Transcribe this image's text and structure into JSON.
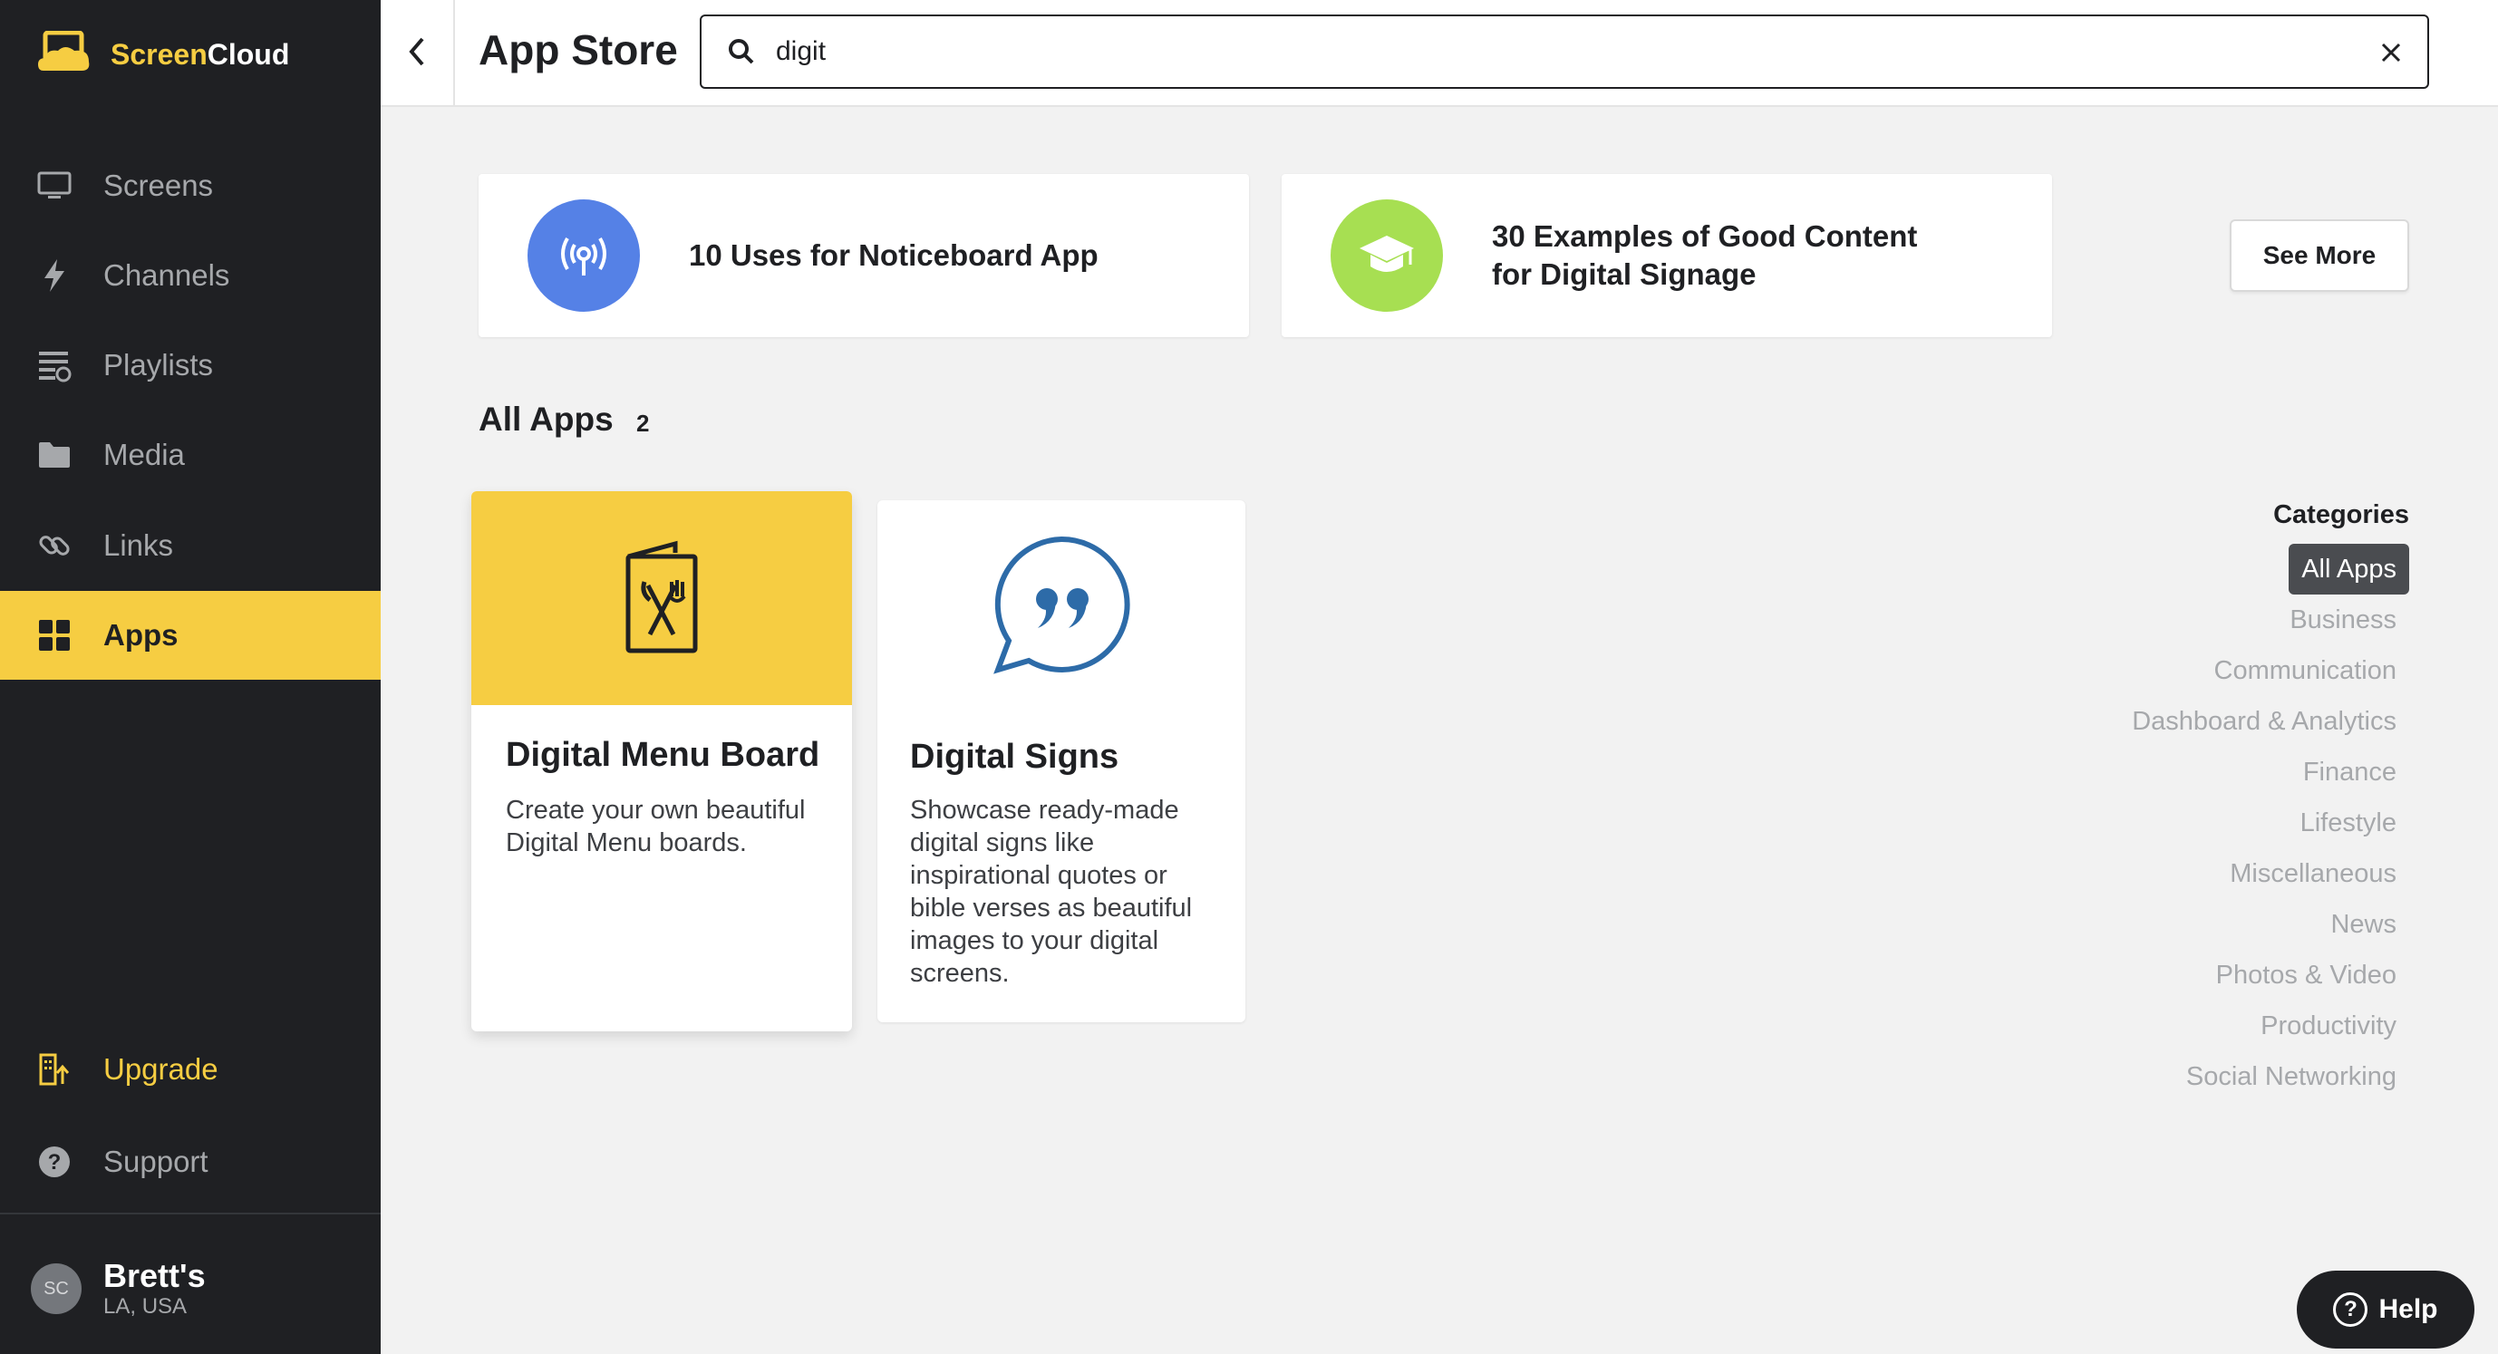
{
  "brand": {
    "name_part1": "Screen",
    "name_part2": "Cloud",
    "accent": "#f6cd42",
    "dark": "#1f2023"
  },
  "sidebar": {
    "items": [
      {
        "label": "Screens",
        "icon": "monitor-icon"
      },
      {
        "label": "Channels",
        "icon": "lightning-icon"
      },
      {
        "label": "Playlists",
        "icon": "playlist-icon"
      },
      {
        "label": "Media",
        "icon": "folder-icon"
      },
      {
        "label": "Links",
        "icon": "link-icon"
      },
      {
        "label": "Apps",
        "icon": "apps-grid-icon",
        "active": true
      }
    ],
    "upgrade": {
      "label": "Upgrade",
      "icon": "building-upgrade-icon"
    },
    "support": {
      "label": "Support",
      "icon": "question-icon"
    },
    "account": {
      "initials": "SC",
      "name": "Brett's",
      "location": "LA, USA"
    }
  },
  "header": {
    "title": "App Store",
    "search": {
      "value": "digit",
      "placeholder": ""
    }
  },
  "featured": [
    {
      "title": "10 Uses for Noticeboard App",
      "icon": "broadcast-icon",
      "color": "#5581e6"
    },
    {
      "title_line1": "30 Examples of Good Content",
      "title_line2": "for Digital Signage",
      "icon": "graduation-cap-icon",
      "color": "#a7df52"
    }
  ],
  "see_more_label": "See More",
  "all_apps": {
    "title": "All Apps",
    "count": "2"
  },
  "apps": [
    {
      "title": "Digital Menu Board",
      "description": "Create your own beautiful Digital Menu boards.",
      "icon": "menu-cutlery-icon"
    },
    {
      "title": "Digital Signs",
      "description": "Showcase ready-made digital signs like inspirational quotes or bible verses as beautiful images to your digital screens.",
      "icon": "quote-bubble-icon"
    }
  ],
  "categories": {
    "heading": "Categories",
    "items": [
      "All Apps",
      "Business",
      "Communication",
      "Dashboard & Analytics",
      "Finance",
      "Lifestyle",
      "Miscellaneous",
      "News",
      "Photos & Video",
      "Productivity",
      "Social Networking"
    ]
  },
  "help_label": "Help"
}
